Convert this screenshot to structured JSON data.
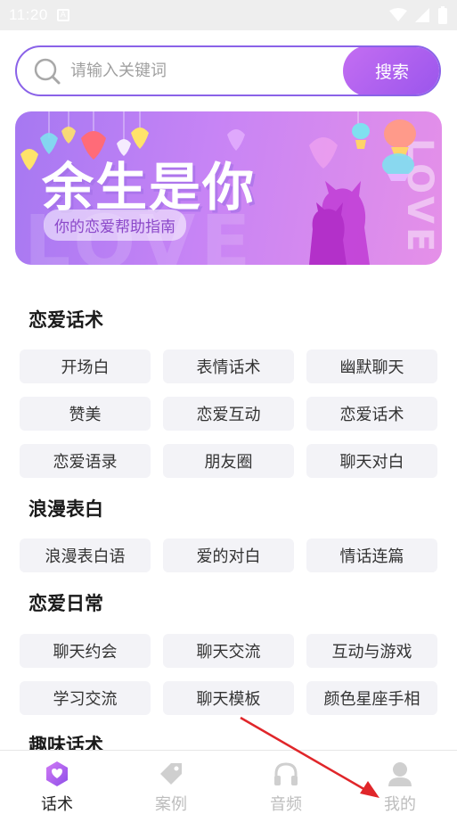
{
  "status_bar": {
    "time": "11:20",
    "icons": [
      "a-notification-icon",
      "wifi-icon",
      "signal-icon",
      "battery-icon"
    ]
  },
  "search": {
    "placeholder": "请输入关键词",
    "button_label": "搜索"
  },
  "banner": {
    "title": "余生是你",
    "subtitle": "你的恋爱帮助指南",
    "bg_word": "LOVE",
    "side_word": "LOVE"
  },
  "sections": [
    {
      "title": "恋爱话术",
      "items": [
        "开场白",
        "表情话术",
        "幽默聊天",
        "赞美",
        "恋爱互动",
        "恋爱话术",
        "恋爱语录",
        "朋友圈",
        "聊天对白"
      ]
    },
    {
      "title": "浪漫表白",
      "items": [
        "浪漫表白语",
        "爱的对白",
        "情话连篇"
      ]
    },
    {
      "title": "恋爱日常",
      "items": [
        "聊天约会",
        "聊天交流",
        "互动与游戏",
        "学习交流",
        "聊天模板",
        "颜色星座手相"
      ]
    },
    {
      "title": "趣味话术",
      "items": []
    }
  ],
  "bottom_nav": [
    {
      "label": "话术",
      "icon": "chat-hexagon-icon",
      "active": true
    },
    {
      "label": "案例",
      "icon": "tag-icon",
      "active": false
    },
    {
      "label": "音频",
      "icon": "headphones-icon",
      "active": false
    },
    {
      "label": "我的",
      "icon": "user-icon",
      "active": false
    }
  ],
  "colors": {
    "accent": "#9a55ec",
    "accent_light": "#c46ef2",
    "chip_bg": "#f3f3f7",
    "annotation_arrow": "#e0262a"
  }
}
